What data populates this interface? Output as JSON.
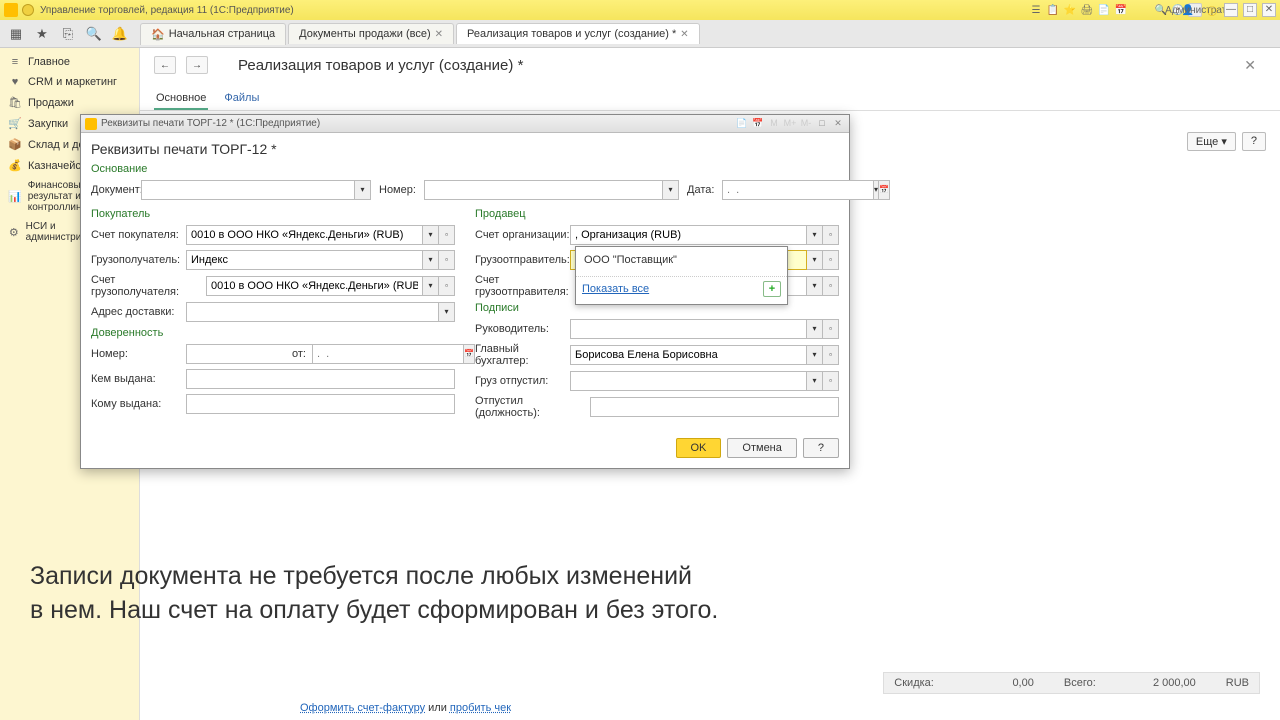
{
  "app": {
    "title": "Управление торговлей, редакция 11  (1С:Предприятие)",
    "user": "Администратор"
  },
  "tabs": {
    "home": "Начальная страница",
    "t1": "Документы продажи (все)",
    "t2": "Реализация товаров и услуг (создание) *"
  },
  "sidebar": {
    "items": [
      {
        "icon": "≡",
        "label": "Главное"
      },
      {
        "icon": "♥",
        "label": "CRM и маркетинг"
      },
      {
        "icon": "🛍",
        "label": "Продажи"
      },
      {
        "icon": "🛒",
        "label": "Закупки"
      },
      {
        "icon": "📦",
        "label": "Склад и доставка"
      },
      {
        "icon": "💰",
        "label": "Казначейство"
      },
      {
        "icon": "📊",
        "label": "Финансовый результат и контроллинг"
      },
      {
        "icon": "⚙",
        "label": "НСИ и администрирование"
      }
    ]
  },
  "page": {
    "title": "Реализация товаров и услуг (создание) *",
    "subtabs": {
      "main": "Основное",
      "files": "Файлы"
    },
    "more": "Еще",
    "help": "?"
  },
  "dialog": {
    "wintitle": "Реквизиты печати ТОРГ-12 *  (1С:Предприятие)",
    "title": "Реквизиты печати ТОРГ-12 *",
    "sections": {
      "base": "Основание",
      "buyer": "Покупатель",
      "seller": "Продавец",
      "proxy": "Доверенность",
      "sign": "Подписи"
    },
    "labels": {
      "document": "Документ:",
      "number": "Номер:",
      "date": "Дата:",
      "buyer_account": "Счет покупателя:",
      "consignee": "Грузополучатель:",
      "consignee_account": "Счет грузополучателя:",
      "delivery_addr": "Адрес доставки:",
      "proxy_number": "Номер:",
      "proxy_from": "от:",
      "issued_by": "Кем выдана:",
      "issued_to": "Кому выдана:",
      "org_account": "Счет организации:",
      "shipper": "Грузоотправитель:",
      "shipper_account": "Счет грузоотправителя:",
      "director": "Руководитель:",
      "accountant": "Главный бухгалтер:",
      "released": "Груз отпустил:",
      "released_pos": "Отпустил (должность):"
    },
    "values": {
      "buyer_account": "0010 в ООО НКО «Яндекс.Деньги» (RUB)",
      "consignee": "Индекс",
      "consignee_account": "0010 в ООО НКО «Яндекс.Деньги» (RUB)",
      "org_account": ", Организация (RUB)",
      "accountant": "Борисова Елена Борисовна",
      "date_placeholder": ".  .",
      "proxy_date": ".  ."
    },
    "dropdown": {
      "item1": "ООО \"Поставщик\"",
      "show_all": "Показать все"
    },
    "buttons": {
      "ok": "OK",
      "cancel": "Отмена",
      "help": "?"
    }
  },
  "overlay": {
    "line1": "Записи документа не требуется после любых изменений",
    "line2": "в нем. Наш счет на оплату будет сформирован и без этого."
  },
  "status": {
    "discount_lbl": "Скидка:",
    "discount": "0,00",
    "total_lbl": "Всего:",
    "total": "2 000,00",
    "cur": "RUB"
  },
  "bottom": {
    "invoice": "Оформить счет-фактуру",
    "or": " или ",
    "cheque": "пробить чек"
  }
}
